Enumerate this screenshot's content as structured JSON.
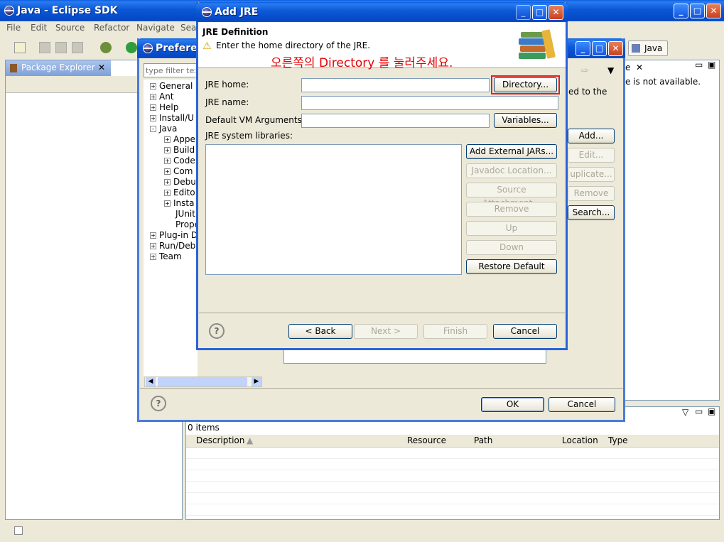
{
  "main_window": {
    "title": "Java - Eclipse SDK",
    "menu": [
      "File",
      "Edit",
      "Source",
      "Refactor",
      "Navigate",
      "Sea"
    ],
    "perspective": "Java",
    "package_explorer_tab": "Package Explorer",
    "right_view_tab_fragment": "e",
    "right_view_text": "e is not available.",
    "right_view_text2": "ed to the",
    "problems": {
      "count": "0 items",
      "columns": [
        "Description",
        "Resource",
        "Path",
        "Location",
        "Type"
      ]
    }
  },
  "preferences": {
    "title": "Prefere",
    "filter_placeholder": "type filter tex",
    "tree": [
      {
        "label": "General",
        "level": 0,
        "expander": "+"
      },
      {
        "label": "Ant",
        "level": 0,
        "expander": "+"
      },
      {
        "label": "Help",
        "level": 0,
        "expander": "+"
      },
      {
        "label": "Install/U",
        "level": 0,
        "expander": "+"
      },
      {
        "label": "Java",
        "level": 0,
        "expander": "-"
      },
      {
        "label": "Appe",
        "level": 1,
        "expander": "+"
      },
      {
        "label": "Build",
        "level": 1,
        "expander": "+"
      },
      {
        "label": "Code",
        "level": 1,
        "expander": "+"
      },
      {
        "label": "Com",
        "level": 1,
        "expander": "+"
      },
      {
        "label": "Debu",
        "level": 1,
        "expander": "+"
      },
      {
        "label": "Edito",
        "level": 1,
        "expander": "+"
      },
      {
        "label": "Insta",
        "level": 1,
        "expander": "+"
      },
      {
        "label": "JUnit",
        "level": 1,
        "expander": ""
      },
      {
        "label": "Prope",
        "level": 1,
        "expander": ""
      },
      {
        "label": "Plug-in D",
        "level": 0,
        "expander": "+"
      },
      {
        "label": "Run/Deb",
        "level": 0,
        "expander": "+"
      },
      {
        "label": "Team",
        "level": 0,
        "expander": "+"
      }
    ],
    "side_buttons": [
      "Add...",
      "Edit...",
      "uplicate...",
      "Remove",
      "Search..."
    ],
    "ok": "OK",
    "cancel": "Cancel"
  },
  "add_jre": {
    "title": "Add JRE",
    "header_title": "JRE Definition",
    "header_message": "Enter the home directory of the JRE.",
    "annotation": "오른쪽의 Directory 를 눌러주세요.",
    "annotation_color": "#e60000",
    "jre_home_label": "JRE home:",
    "jre_home_value": "",
    "jre_name_label": "JRE name:",
    "jre_name_value": "",
    "vm_args_label": "Default VM Arguments:",
    "vm_args_value": "",
    "libraries_label": "JRE system libraries:",
    "directory_button": "Directory...",
    "variables_button": "Variables...",
    "lib_buttons": [
      {
        "label": "Add External JARs...",
        "enabled": true
      },
      {
        "label": "Javadoc Location...",
        "enabled": false
      },
      {
        "label": "Source Attachment...",
        "enabled": false
      },
      {
        "label": "Remove",
        "enabled": false
      },
      {
        "label": "Up",
        "enabled": false
      },
      {
        "label": "Down",
        "enabled": false
      },
      {
        "label": "Restore Default",
        "enabled": true
      }
    ],
    "back": "< Back",
    "next": "Next >",
    "finish": "Finish",
    "cancel": "Cancel"
  }
}
